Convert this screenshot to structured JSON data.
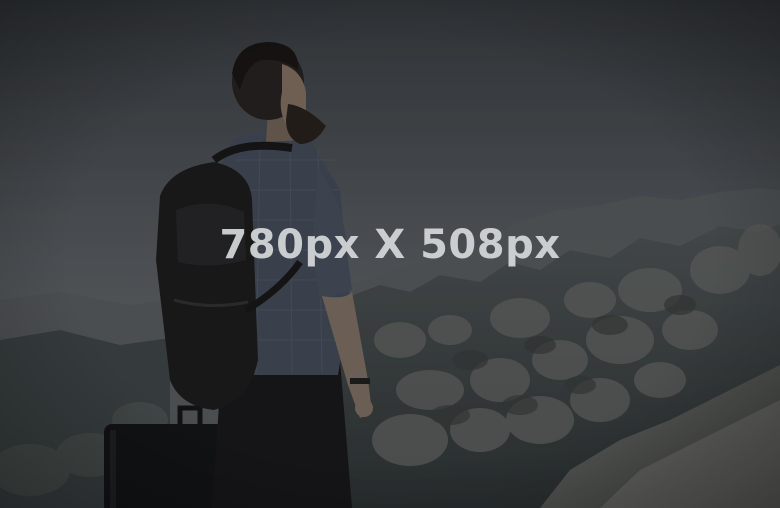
{
  "placeholder": {
    "dimension_text": "780px X 508px"
  },
  "colors": {
    "sky_top": "#3a3e43",
    "sky_haze": "#6b7177",
    "rock_light": "#6a6d6c",
    "rock_dark": "#3b3f3e",
    "figure_dark": "#1c1d1f",
    "shirt": "#4b5563"
  }
}
